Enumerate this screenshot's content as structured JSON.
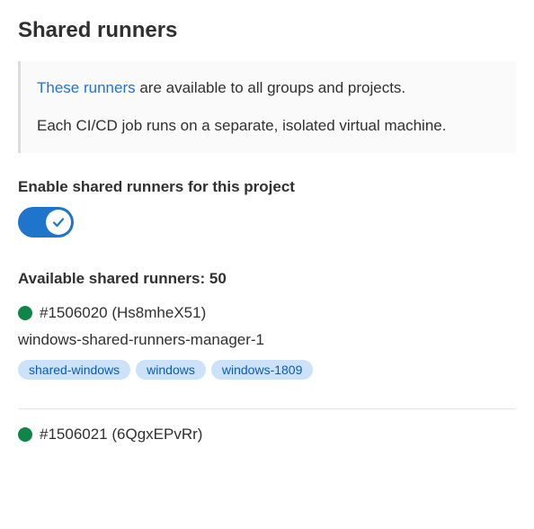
{
  "title": "Shared runners",
  "info": {
    "link_text": "These runners",
    "line1_rest": " are available to all groups and projects.",
    "line2": "Each CI/CD job runs on a separate, isolated virtual machine."
  },
  "enable": {
    "label": "Enable shared runners for this project",
    "on": true
  },
  "available": {
    "label_prefix": "Available shared runners: ",
    "count": "50"
  },
  "runners": [
    {
      "status_color": "#108548",
      "id_text": "#1506020 (Hs8mheX51)",
      "description": "windows-shared-runners-manager-1",
      "tags": [
        "shared-windows",
        "windows",
        "windows-1809"
      ]
    },
    {
      "status_color": "#108548",
      "id_text": "#1506021 (6QgxEPvRr)"
    }
  ]
}
